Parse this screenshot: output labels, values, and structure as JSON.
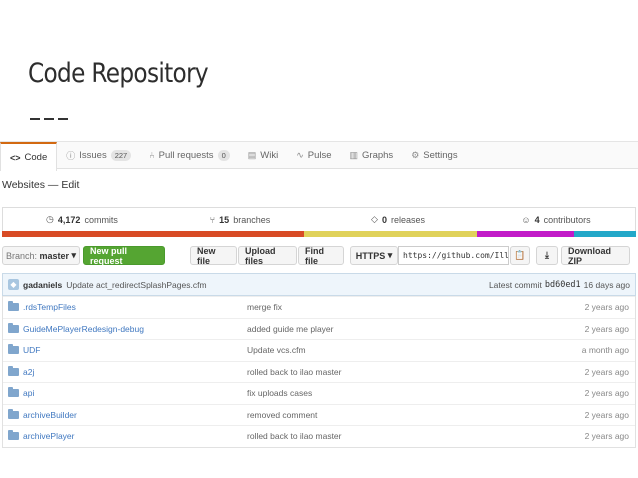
{
  "slide": {
    "title": "Code Repository"
  },
  "tabs": [
    {
      "icon": "<>",
      "label": "Code",
      "active": true
    },
    {
      "icon": "ⓘ",
      "label": "Issues",
      "count": "227"
    },
    {
      "icon": "⑃",
      "label": "Pull requests",
      "count": "0"
    },
    {
      "icon": "▤",
      "label": "Wiki"
    },
    {
      "icon": "∿",
      "label": "Pulse"
    },
    {
      "icon": "▥",
      "label": "Graphs"
    },
    {
      "icon": "⚙",
      "label": "Settings"
    }
  ],
  "breadcrumb": "Websites — Edit",
  "stats": {
    "commits": {
      "value": "4,172",
      "label": "commits"
    },
    "branches": {
      "value": "15",
      "label": "branches"
    },
    "releases": {
      "value": "0",
      "label": "releases"
    },
    "contributors": {
      "value": "4",
      "label": "contributors"
    }
  },
  "language_colors": [
    "#d84b25",
    "#e0d25a",
    "#c21bc8",
    "#23a8c9"
  ],
  "toolbar": {
    "branch_prefix": "Branch:",
    "branch": "master",
    "new_pull_request": "New pull request",
    "new_file": "New file",
    "upload_files": "Upload files",
    "find_file": "Find file",
    "protocol": "HTTPS",
    "clone_url": "https://github.com/Illi",
    "download_zip": "Download ZIP"
  },
  "latest_commit": {
    "user": "gadaniels",
    "message": "Update act_redirectSplashPages.cfm",
    "prefix": "Latest commit",
    "sha": "bd60ed1",
    "age": "16 days ago"
  },
  "files": [
    {
      "name": ".rdsTempFiles",
      "message": "merge fix",
      "age": "2 years ago"
    },
    {
      "name": "GuideMePlayerRedesign-debug",
      "message": "added guide me player",
      "age": "2 years ago"
    },
    {
      "name": "UDF",
      "message": "Update vcs.cfm",
      "age": "a month ago"
    },
    {
      "name": "a2j",
      "message": "rolled back to ilao master",
      "age": "2 years ago"
    },
    {
      "name": "api",
      "message": "fix uploads cases",
      "age": "2 years ago"
    },
    {
      "name": "archiveBuilder",
      "message": "removed comment",
      "age": "2 years ago"
    },
    {
      "name": "archivePlayer",
      "message": "rolled back to ilao master",
      "age": "2 years ago"
    }
  ]
}
